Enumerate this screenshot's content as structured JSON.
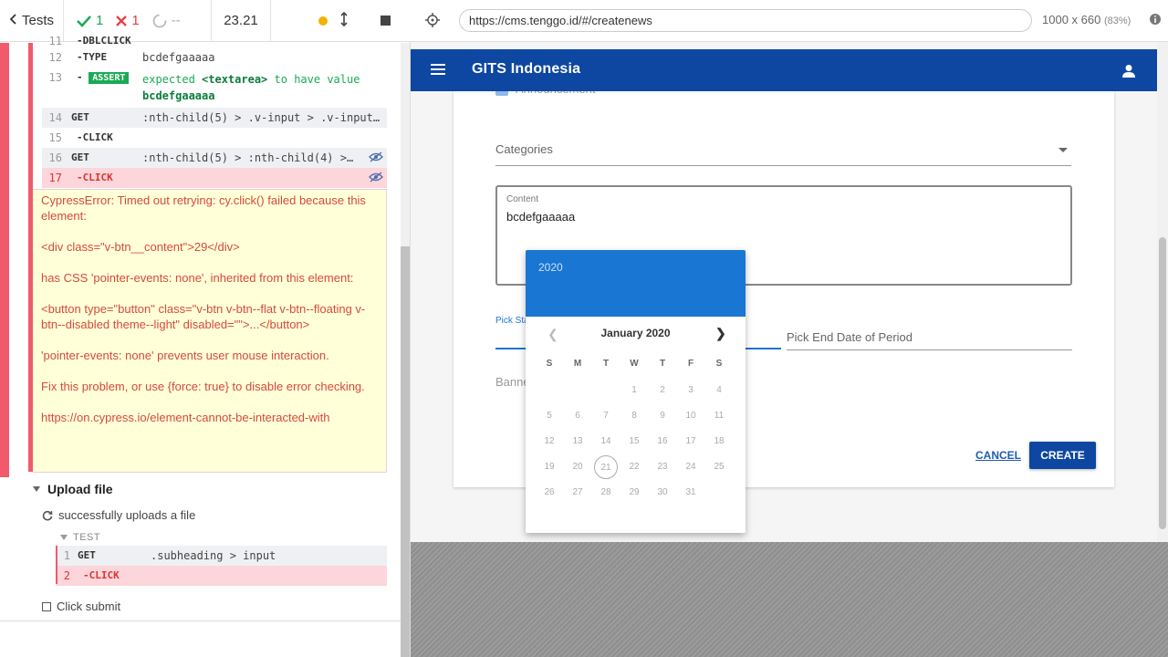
{
  "runner": {
    "tests_label": "Tests",
    "passed": "1",
    "failed": "1",
    "pending": "--",
    "duration": "23.21"
  },
  "commands": [
    {
      "num": "11",
      "name": "DBLCLICK",
      "msg": ""
    },
    {
      "num": "12",
      "name": "TYPE",
      "msg": "bcdefgaaaaa"
    },
    {
      "num": "13",
      "name": "ASSERT",
      "msg_prefix": "expected",
      "msg_elem": "<textarea>",
      "msg_mid": "to have value",
      "msg_value": "bcdefgaaaaa"
    },
    {
      "num": "14",
      "name": "GET",
      "msg": ":nth-child(5) > .v-input > .v-input…"
    },
    {
      "num": "15",
      "name": "CLICK",
      "msg": ""
    },
    {
      "num": "16",
      "name": "GET",
      "msg": ":nth-child(5) > :nth-child(4) >…"
    },
    {
      "num": "17",
      "name": "CLICK",
      "msg": ""
    }
  ],
  "error": {
    "line1": "CypressError: Timed out retrying: cy.click() failed because this element:",
    "line2": "<div class=\"v-btn__content\">29</div>",
    "line3": "has CSS 'pointer-events: none', inherited from this element:",
    "line4": "<button type=\"button\" class=\"v-btn v-btn--flat v-btn--floating v-btn--disabled theme--light\" disabled=\"\">...</button>",
    "line5": "'pointer-events: none' prevents user mouse interaction.",
    "line6": "Fix this problem, or use {force: true} to disable error checking.",
    "line7": "https://on.cypress.io/element-cannot-be-interacted-with"
  },
  "suite": {
    "title": "Upload file",
    "test_title": "successfully uploads a file",
    "test_label": "TEST",
    "sub_commands": [
      {
        "num": "1",
        "name": "GET",
        "msg": ".subheading > input"
      },
      {
        "num": "2",
        "name": "CLICK",
        "msg": ""
      }
    ],
    "next_test": "Click submit"
  },
  "url_bar": {
    "url": "https://cms.tenggo.id/#/createnews",
    "size": "1000 x 660",
    "zoom": "(83%)"
  },
  "app": {
    "title": "GITS Indonesia",
    "announcement": "Announcement",
    "categories": "Categories",
    "content_label": "Content",
    "content_value": "bcdefgaaaaa",
    "start_label": "Pick Start Date of Period",
    "end_label": "Pick End Date of Period",
    "banner_label": "Banner",
    "cancel": "CANCEL",
    "create": "CREATE"
  },
  "picker": {
    "year": "2020",
    "month": "January 2020",
    "dow": [
      "S",
      "M",
      "T",
      "W",
      "T",
      "F",
      "S"
    ],
    "weeks": [
      [
        "",
        "",
        "",
        "1",
        "2",
        "3",
        "4"
      ],
      [
        "5",
        "6",
        "7",
        "8",
        "9",
        "10",
        "11"
      ],
      [
        "12",
        "13",
        "14",
        "15",
        "16",
        "17",
        "18"
      ],
      [
        "19",
        "20",
        "21",
        "22",
        "23",
        "24",
        "25"
      ],
      [
        "26",
        "27",
        "28",
        "29",
        "30",
        "31",
        ""
      ]
    ],
    "today": "21"
  },
  "colors": {
    "pass": "#1aaa55",
    "fail": "#e64040",
    "appbar": "#0d47a1",
    "picker_header": "#1976d2"
  }
}
